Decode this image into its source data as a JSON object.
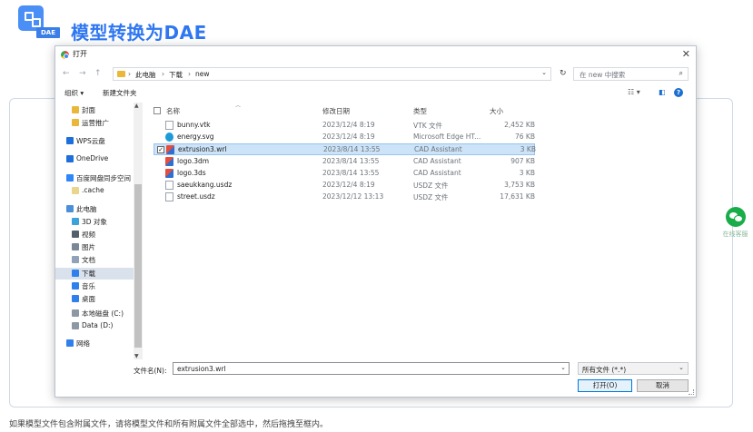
{
  "header": {
    "badge_text": "DAE",
    "title": "模型转换为DAE"
  },
  "dialog": {
    "title": "打开",
    "nav": {
      "back": "←",
      "forward": "→",
      "up": "↑",
      "breadcrumbs": [
        "此电脑",
        "下载",
        "new"
      ],
      "separator": "›",
      "search_placeholder": "在 new 中搜索"
    },
    "toolbar": {
      "organize": "组织 ▾",
      "new_folder": "新建文件夹"
    },
    "sidebar": {
      "items": [
        {
          "label": "封面",
          "icon": "folder-icon",
          "color": "#e9b83b"
        },
        {
          "label": "运营推广",
          "icon": "folder-icon",
          "color": "#e9b83b"
        },
        {
          "label": "WPS云盘",
          "icon": "cloud-icon",
          "color": "#1e6fd9"
        },
        {
          "label": "OneDrive",
          "icon": "cloud-icon",
          "color": "#1e6fd9"
        },
        {
          "label": "百度网盘同步空间",
          "icon": "baidu-icon",
          "color": "#2f86f6"
        },
        {
          "label": ".cache",
          "icon": "folder-icon",
          "color": "#e9d58b"
        },
        {
          "label": "此电脑",
          "icon": "computer-icon",
          "color": "#4a90d9"
        },
        {
          "label": "3D 对象",
          "icon": "cube-icon",
          "color": "#3ba3d8"
        },
        {
          "label": "视频",
          "icon": "video-icon",
          "color": "#555f6b"
        },
        {
          "label": "图片",
          "icon": "picture-icon",
          "color": "#7a8796"
        },
        {
          "label": "文档",
          "icon": "document-icon",
          "color": "#8fa2b8"
        },
        {
          "label": "下载",
          "icon": "download-icon",
          "color": "#2f80ed"
        },
        {
          "label": "音乐",
          "icon": "music-icon",
          "color": "#2f80ed"
        },
        {
          "label": "桌面",
          "icon": "desktop-icon",
          "color": "#2f80ed"
        },
        {
          "label": "本地磁盘 (C:)",
          "icon": "drive-icon",
          "color": "#8d98a5"
        },
        {
          "label": "Data (D:)",
          "icon": "drive-icon",
          "color": "#8d98a5"
        },
        {
          "label": "网络",
          "icon": "network-icon",
          "color": "#2f80ed"
        }
      ],
      "selected": "下载"
    },
    "columns": {
      "name": "名称",
      "date": "修改日期",
      "type": "类型",
      "size": "大小"
    },
    "files": [
      {
        "name": "bunny.vtk",
        "date": "2023/12/4 8:19",
        "type": "VTK 文件",
        "size": "2,452 KB",
        "icon": "file-icon",
        "selected": false
      },
      {
        "name": "energy.svg",
        "date": "2023/12/4 8:19",
        "type": "Microsoft Edge HT...",
        "size": "76 KB",
        "icon": "edge-icon",
        "selected": false
      },
      {
        "name": "extrusion3.wrl",
        "date": "2023/8/14 13:55",
        "type": "CAD Assistant",
        "size": "3 KB",
        "icon": "cad-icon",
        "selected": true
      },
      {
        "name": "logo.3dm",
        "date": "2023/8/14 13:55",
        "type": "CAD Assistant",
        "size": "907 KB",
        "icon": "cad-icon",
        "selected": false
      },
      {
        "name": "logo.3ds",
        "date": "2023/8/14 13:55",
        "type": "CAD Assistant",
        "size": "3 KB",
        "icon": "cad-icon",
        "selected": false
      },
      {
        "name": "saeukkang.usdz",
        "date": "2023/12/4 8:19",
        "type": "USDZ 文件",
        "size": "3,753 KB",
        "icon": "file-icon",
        "selected": false
      },
      {
        "name": "street.usdz",
        "date": "2023/12/12 13:13",
        "type": "USDZ 文件",
        "size": "17,631 KB",
        "icon": "file-icon",
        "selected": false
      }
    ],
    "filename_label": "文件名(N):",
    "filename_value": "extrusion3.wrl",
    "filter_value": "所有文件 (*.*)",
    "open_button": "打开(O)",
    "cancel_button": "取消"
  },
  "wechat_label": "在线客服",
  "footer_note": "如果模型文件包含附属文件，请将模型文件和所有附属文件全部选中，然后拖拽至框内。"
}
